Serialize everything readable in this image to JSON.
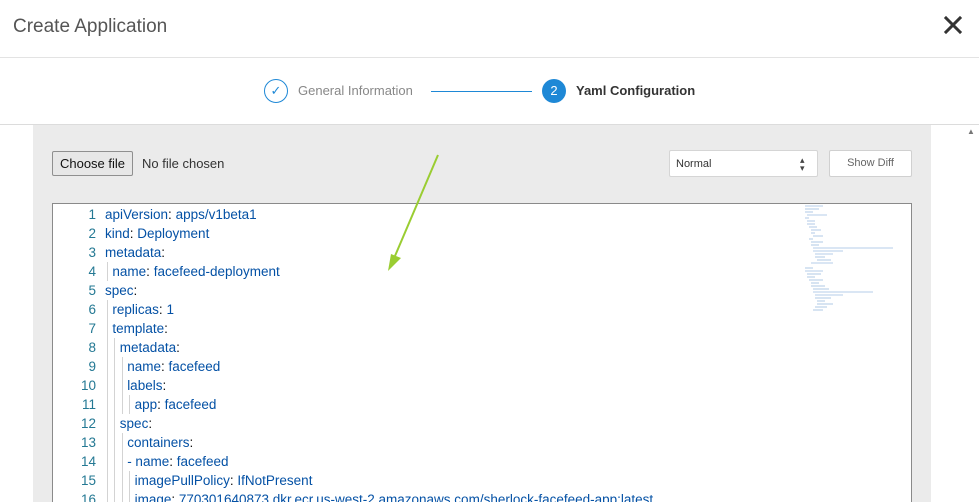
{
  "header": {
    "title": "Create Application",
    "close_icon": "close-icon"
  },
  "steps": [
    {
      "number": "✓",
      "label": "General Information",
      "state": "completed"
    },
    {
      "number": "2",
      "label": "Yaml Configuration",
      "state": "active"
    }
  ],
  "toolbar": {
    "choose_file_label": "Choose file",
    "file_status": "No file chosen",
    "mode_value": "Normal",
    "show_diff_label": "Show Diff"
  },
  "editor": {
    "lines": [
      {
        "num": "1",
        "key": "apiVersion",
        "sep": ": ",
        "value": "apps/v1beta1"
      },
      {
        "num": "2",
        "key": "kind",
        "sep": ": ",
        "value": "Deployment"
      },
      {
        "num": "3",
        "key": "metadata",
        "sep": ":",
        "value": ""
      },
      {
        "num": "4",
        "key": "name",
        "sep": ": ",
        "value": "facefeed-deployment"
      },
      {
        "num": "5",
        "key": "spec",
        "sep": ":",
        "value": ""
      },
      {
        "num": "6",
        "key": "replicas",
        "sep": ": ",
        "value": "1"
      },
      {
        "num": "7",
        "key": "template",
        "sep": ":",
        "value": ""
      },
      {
        "num": "8",
        "key": "metadata",
        "sep": ":",
        "value": ""
      },
      {
        "num": "9",
        "key": "name",
        "sep": ": ",
        "value": "facefeed"
      },
      {
        "num": "10",
        "key": "labels",
        "sep": ":",
        "value": ""
      },
      {
        "num": "11",
        "key": "app",
        "sep": ": ",
        "value": "facefeed"
      },
      {
        "num": "12",
        "key": "spec",
        "sep": ":",
        "value": ""
      },
      {
        "num": "13",
        "key": "containers",
        "sep": ":",
        "value": ""
      },
      {
        "num": "14",
        "key": "- name",
        "sep": ": ",
        "value": "facefeed"
      },
      {
        "num": "15",
        "key": "imagePullPolicy",
        "sep": ": ",
        "value": "IfNotPresent"
      },
      {
        "num": "16",
        "key": "image",
        "sep": ": ",
        "value": "770301640873.dkr.ecr.us-west-2.amazonaws.com/sherlock-facefeed-app:latest"
      }
    ]
  },
  "colors": {
    "accent": "#1e88d6",
    "code_text": "#0451a5",
    "line_number": "#237893",
    "annotation_arrow": "#9acd32"
  }
}
